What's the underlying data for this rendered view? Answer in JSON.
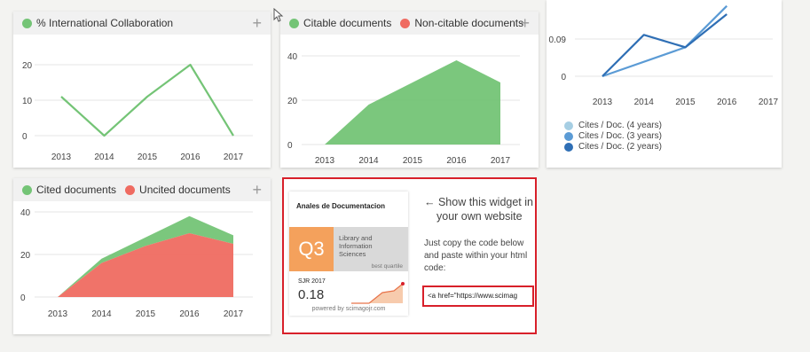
{
  "panels": {
    "intl": {
      "legend": [
        "% International Collaboration"
      ],
      "color": "#74c476"
    },
    "citable": {
      "legend": [
        "Citable documents",
        "Non-citable documents"
      ],
      "colors": [
        "#74c476",
        "#ef6b61"
      ]
    },
    "cites": {
      "legend": [
        "Cites / Doc. (4 years)",
        "Cites / Doc. (3 years)",
        "Cites / Doc. (2 years)"
      ],
      "colors": [
        "#a6cee3",
        "#5b9bd5",
        "#2f6fb5"
      ]
    },
    "cited": {
      "legend": [
        "Cited documents",
        "Uncited documents"
      ],
      "colors": [
        "#74c476",
        "#ef6b61"
      ]
    }
  },
  "chart_data": [
    {
      "type": "line",
      "categories": [
        "2013",
        "2014",
        "2015",
        "2016",
        "2017"
      ],
      "series": [
        {
          "name": "% International Collaboration",
          "values": [
            11,
            0,
            11,
            20,
            0
          ]
        }
      ],
      "yticks": [
        "0",
        "10",
        "20"
      ],
      "ylim": [
        0,
        20
      ]
    },
    {
      "type": "area",
      "categories": [
        "2013",
        "2014",
        "2015",
        "2016",
        "2017"
      ],
      "series": [
        {
          "name": "Citable documents",
          "values": [
            0,
            18,
            28,
            38,
            28
          ]
        }
      ],
      "yticks": [
        "0",
        "20",
        "40"
      ],
      "ylim": [
        0,
        40
      ]
    },
    {
      "type": "line",
      "categories": [
        "2013",
        "2014",
        "2015",
        "2016",
        "2017"
      ],
      "series": [
        {
          "name": "Cites / Doc. (3 years)",
          "values": [
            0,
            null,
            0.07,
            0.17,
            null
          ]
        },
        {
          "name": "Cites / Doc. (2 years)",
          "values": [
            0,
            0.1,
            0.07,
            0.15,
            null
          ]
        }
      ],
      "yticks": [
        "0",
        "0.09"
      ],
      "ylim": [
        0,
        0.09
      ]
    },
    {
      "type": "area",
      "categories": [
        "2013",
        "2014",
        "2015",
        "2016",
        "2017"
      ],
      "series": [
        {
          "name": "Cited documents",
          "values": [
            0,
            2,
            4,
            8,
            4
          ]
        },
        {
          "name": "Uncited documents",
          "values": [
            0,
            16,
            24,
            30,
            25
          ]
        }
      ],
      "yticks": [
        "0",
        "20",
        "40"
      ],
      "ylim": [
        0,
        40
      ]
    }
  ],
  "widget": {
    "journal": "Anales de Documentacion",
    "quartile": "Q3",
    "category": [
      "Library and",
      "Information",
      "Sciences"
    ],
    "best_quartile": "best quartile",
    "sjr_label": "SJR 2017",
    "sjr_value": "0.18",
    "powered": "powered by scimagojr.com",
    "heading": [
      "← Show this widget in",
      "your own website"
    ],
    "instructions": [
      "Just copy the code below",
      "and paste within your html",
      "code:"
    ],
    "code": "<a href=\"https://www.scimag"
  }
}
